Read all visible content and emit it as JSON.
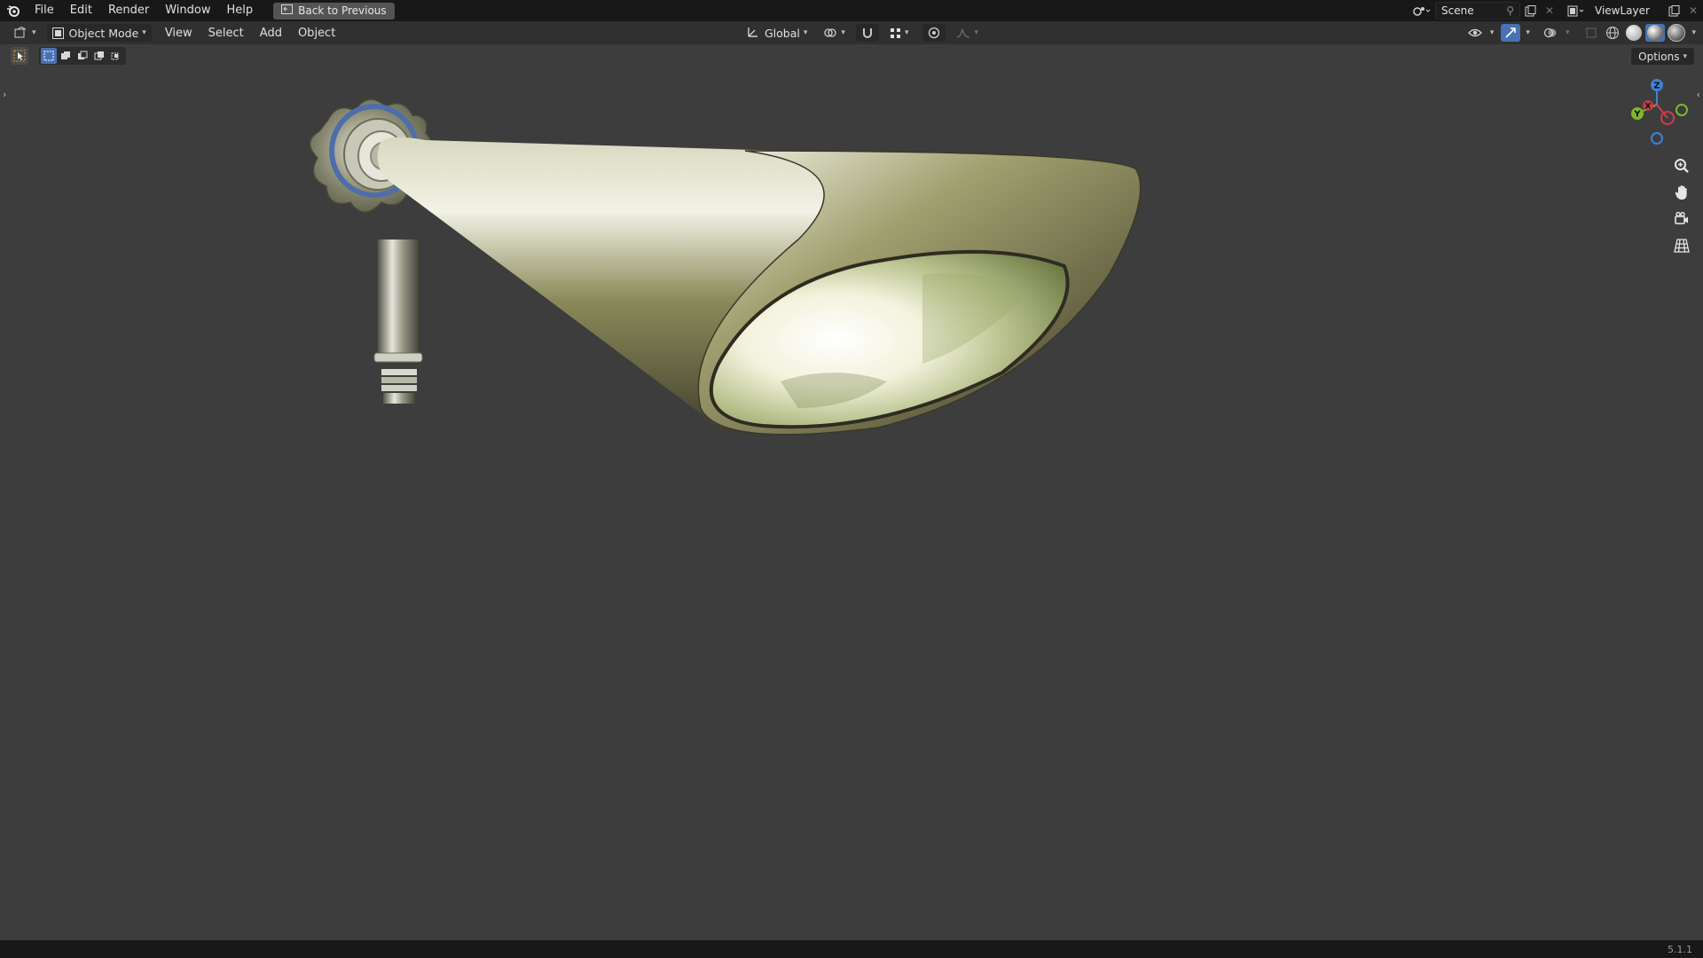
{
  "menubar": {
    "items": [
      "File",
      "Edit",
      "Render",
      "Window",
      "Help"
    ],
    "back_label": "Back to Previous"
  },
  "top_right": {
    "scene": "Scene",
    "view_layer": "ViewLayer"
  },
  "header": {
    "mode": "Object Mode",
    "menus": [
      "View",
      "Select",
      "Add",
      "Object"
    ],
    "orientation": "Global"
  },
  "options_label": "Options",
  "gizmo": {
    "z": "Z",
    "y": "Y",
    "x": "X"
  },
  "version": "5.1.1",
  "colors": {
    "selection_accent": "#4772b3",
    "axis_x": "#d03b50",
    "axis_y": "#7fb72a",
    "axis_z": "#3c82d6"
  },
  "icons": [
    "blender-logo-icon",
    "back-icon",
    "editor-type-icon",
    "object-mode-icon",
    "orientation-icon",
    "pivot-icon",
    "snap-icon",
    "snap-target-icon",
    "proportional-icon",
    "falloff-icon",
    "visibility-icon",
    "gizmo-icon",
    "overlay-icon",
    "xray-icon",
    "wireframe-shading-icon",
    "solid-shading-icon",
    "material-shading-icon",
    "rendered-shading-icon",
    "zoom-icon",
    "pan-icon",
    "camera-icon",
    "perspective-icon"
  ]
}
